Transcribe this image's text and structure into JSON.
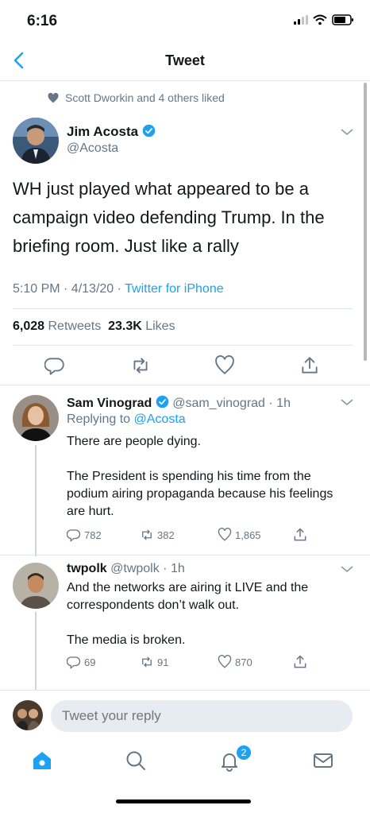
{
  "status": {
    "time": "6:16"
  },
  "nav": {
    "title": "Tweet"
  },
  "social_context": {
    "text": "Scott Dworkin and 4 others liked"
  },
  "tweet": {
    "name": "Jim Acosta",
    "handle": "@Acosta",
    "text": "WH just played what appeared to be a campaign video defending Trump. In the briefing room. Just like a rally",
    "time": "5:10 PM · 4/13/20 · ",
    "source": "Twitter for iPhone",
    "retweets": "6,028",
    "retweets_label": " Retweets  ",
    "likes": "23.3K",
    "likes_label": " Likes"
  },
  "replies": [
    {
      "name": "Sam Vinograd",
      "handle": "@sam_vinograd · 1h",
      "replying_prefix": "Replying to ",
      "replying_to": "@Acosta",
      "text_lines": [
        "There are people dying.",
        "",
        "The President is spending his time from the podium airing propaganda because his feelings are hurt."
      ],
      "reply_count": "782",
      "retweet_count": "382",
      "like_count": "1,865"
    },
    {
      "name": "twpolk",
      "handle": "@twpolk · 1h",
      "text_lines": [
        "And the networks are airing it LIVE and the correspondents don’t walk out.",
        "",
        "The media is broken."
      ],
      "reply_count": "69",
      "retweet_count": "91",
      "like_count": "870"
    }
  ],
  "compose": {
    "placeholder": "Tweet your reply"
  },
  "tabs": {
    "notifications_badge": "2"
  },
  "colors": {
    "accent": "#1da1f2",
    "secondary_text": "#657786",
    "divider": "#e1e8ed"
  },
  "icons": [
    "back-icon",
    "heart-icon",
    "verified-icon",
    "chevron-down-icon",
    "reply-icon",
    "retweet-icon",
    "like-icon",
    "share-icon",
    "home-icon",
    "search-icon",
    "notifications-icon",
    "messages-icon"
  ]
}
